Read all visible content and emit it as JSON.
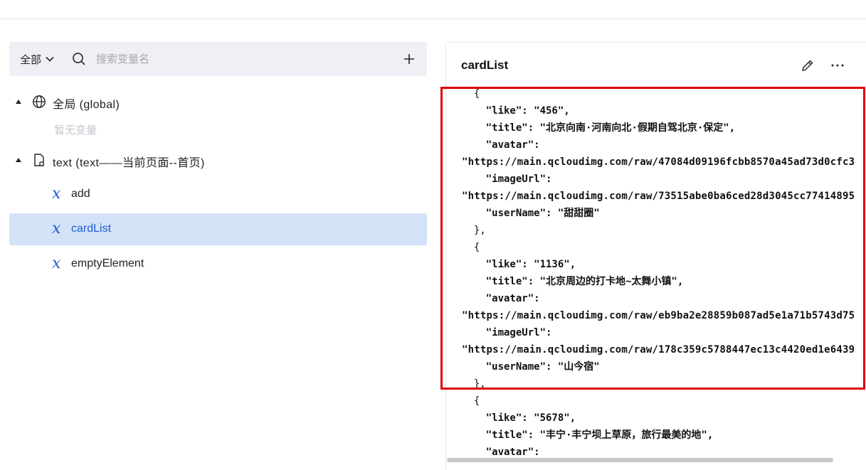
{
  "toolbar": {
    "scope_label": "全部",
    "search_placeholder": "搜索变量名"
  },
  "tree": {
    "global_group": {
      "label": "全局 (global)",
      "empty_text": "暂无变量"
    },
    "page_group": {
      "label": "text (text——当前页面--首页)",
      "variables": [
        {
          "name": "add",
          "selected": false
        },
        {
          "name": "cardList",
          "selected": true
        },
        {
          "name": "emptyElement",
          "selected": false
        }
      ]
    }
  },
  "detail": {
    "title": "cardList",
    "code_lines": [
      "  {",
      "    \"like\": \"456\",",
      "    \"title\": \"北京向南·河南向北·假期自驾北京·保定\",",
      "    \"avatar\":",
      "\"https://main.qcloudimg.com/raw/47084d09196fcbb8570a45ad73d0cfc3",
      "    \"imageUrl\":",
      "\"https://main.qcloudimg.com/raw/73515abe0ba6ced28d3045cc77414895",
      "    \"userName\": \"甜甜圈\"",
      "  },",
      "  {",
      "    \"like\": \"1136\",",
      "    \"title\": \"北京周边的打卡地~太舞小镇\",",
      "    \"avatar\":",
      "\"https://main.qcloudimg.com/raw/eb9ba2e28859b087ad5e1a71b5743d75",
      "    \"imageUrl\":",
      "\"https://main.qcloudimg.com/raw/178c359c5788447ec13c4420ed1e6439",
      "    \"userName\": \"山今宿\"",
      "  },",
      "  {",
      "    \"like\": \"5678\",",
      "    \"title\": \"丰宁·丰宁坝上草原，旅行最美的地\",",
      "    \"avatar\":"
    ]
  },
  "colors": {
    "accent": "#1f5ed2",
    "selected_bg": "#d4e2f8",
    "toolbar_bg": "#eff0f5",
    "highlight": "#e00000"
  }
}
